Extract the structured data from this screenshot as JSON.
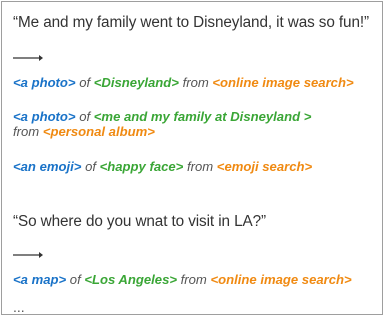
{
  "example1": {
    "quote": "“Me and my family went to Disneyland, it was so fun!”",
    "items": [
      {
        "type": "<a photo>",
        "of": "of",
        "subject": "<Disneyland>",
        "from": "from",
        "source": "<online image search>"
      },
      {
        "type": "<a photo>",
        "of": "of",
        "subject": "<me and my family at Disneyland >",
        "from": "from",
        "source": "<personal album>"
      },
      {
        "type": "<an emoji>",
        "of": "of",
        "subject": "<happy face>",
        "from": "from",
        "source": "<emoji search>"
      }
    ]
  },
  "example2": {
    "quote": "“So where do you wnat to visit in LA?”",
    "items": [
      {
        "type": "<a map>",
        "of": "of",
        "subject": "<Los Angeles>",
        "from": "from",
        "source": "<online image search>"
      }
    ]
  },
  "ellipsis": "...",
  "colors": {
    "type": "#1a73c8",
    "subject": "#3aa636",
    "source": "#f08a12",
    "text": "#333333"
  }
}
